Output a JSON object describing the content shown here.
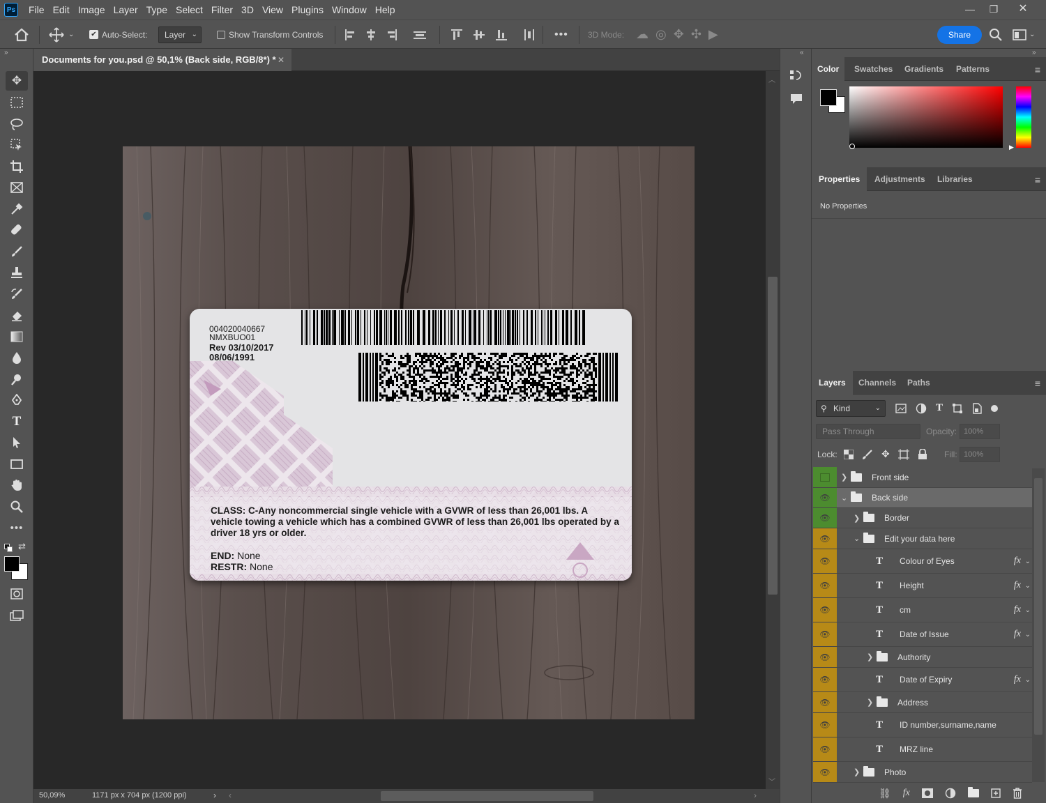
{
  "app": {
    "logo": "Ps"
  },
  "menu": [
    "File",
    "Edit",
    "Image",
    "Layer",
    "Type",
    "Select",
    "Filter",
    "3D",
    "View",
    "Plugins",
    "Window",
    "Help"
  ],
  "window_controls": {
    "minimize": "—",
    "restore": "❐",
    "close": "✕"
  },
  "options": {
    "auto_select_label": "Auto-Select:",
    "auto_select_value": "Layer",
    "transform_label": "Show Transform Controls",
    "mode_3d": "3D Mode:",
    "share": "Share",
    "more": "•••"
  },
  "document": {
    "tab_title": "Documents for you.psd @ 50,1% (Back side, RGB/8*) *",
    "zoom": "50,09%",
    "dimensions": "1171 px x 704 px (1200 ppi)"
  },
  "card": {
    "code1": "004020040667",
    "code2": "NMXBUO01",
    "rev": "Rev 03/10/2017",
    "date": "08/06/1991",
    "class_text": "CLASS: C-Any noncommercial single vehicle with a GVWR of less than 26,001 lbs. A vehicle towing a vehicle which has a combined GVWR of less than 26,001 lbs operated by a driver 18 yrs or older.",
    "end_label": "END:",
    "end_value": "None",
    "restr_label": "RESTR:",
    "restr_value": "None"
  },
  "color_panel": {
    "tabs": [
      "Color",
      "Swatches",
      "Gradients",
      "Patterns"
    ],
    "foreground": "#000000",
    "background": "#ffffff"
  },
  "properties_panel": {
    "tabs": [
      "Properties",
      "Adjustments",
      "Libraries"
    ],
    "message": "No Properties"
  },
  "layers_panel": {
    "tabs": [
      "Layers",
      "Channels",
      "Paths"
    ],
    "kind": "Kind",
    "blend": "Pass Through",
    "opacity_label": "Opacity:",
    "opacity_value": "100%",
    "lock_label": "Lock:",
    "fill_label": "Fill:",
    "fill_value": "100%",
    "layers": [
      {
        "name": "Front side",
        "type": "group",
        "visible": false,
        "expanded": false,
        "depth": 0,
        "color": "green"
      },
      {
        "name": "Back side",
        "type": "group",
        "visible": true,
        "expanded": true,
        "depth": 0,
        "color": "green",
        "selected": true
      },
      {
        "name": "Border",
        "type": "group",
        "visible": true,
        "expanded": false,
        "depth": 1,
        "color": "green"
      },
      {
        "name": "Edit your data here",
        "type": "group",
        "visible": true,
        "expanded": true,
        "depth": 1,
        "color": "yellow"
      },
      {
        "name": "Colour of Eyes",
        "type": "text",
        "visible": true,
        "depth": 2,
        "fx": true,
        "color": "yellow"
      },
      {
        "name": "Height",
        "type": "text",
        "visible": true,
        "depth": 2,
        "fx": true,
        "color": "yellow"
      },
      {
        "name": "cm",
        "type": "text",
        "visible": true,
        "depth": 2,
        "fx": true,
        "color": "yellow"
      },
      {
        "name": "Date of Issue",
        "type": "text",
        "visible": true,
        "depth": 2,
        "fx": true,
        "color": "yellow"
      },
      {
        "name": "Authority",
        "type": "group",
        "visible": true,
        "expanded": false,
        "depth": 2,
        "color": "yellow"
      },
      {
        "name": "Date of Expiry",
        "type": "text",
        "visible": true,
        "depth": 2,
        "fx": true,
        "color": "yellow"
      },
      {
        "name": "Address",
        "type": "group",
        "visible": true,
        "expanded": false,
        "depth": 2,
        "color": "yellow"
      },
      {
        "name": "ID number,surname,name",
        "type": "text",
        "visible": true,
        "depth": 2,
        "color": "yellow"
      },
      {
        "name": "MRZ line",
        "type": "text",
        "visible": true,
        "depth": 2,
        "color": "yellow"
      },
      {
        "name": "Photo",
        "type": "group",
        "visible": true,
        "expanded": false,
        "depth": 1,
        "color": "yellow"
      }
    ]
  }
}
